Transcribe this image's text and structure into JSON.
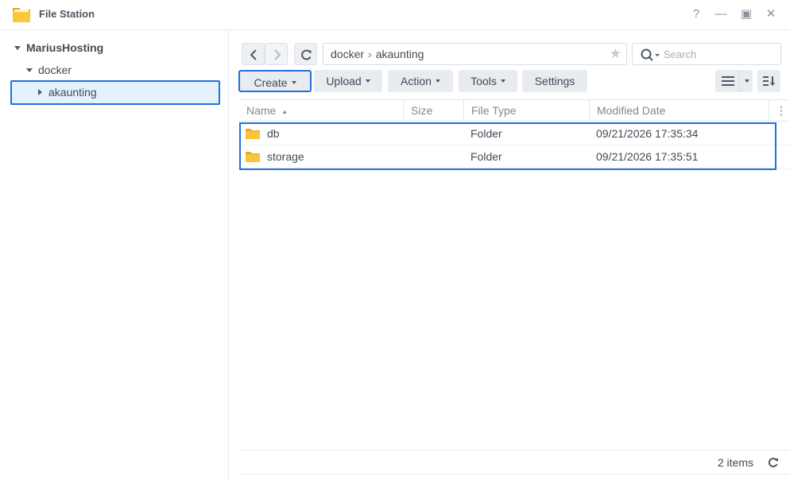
{
  "window": {
    "title": "File Station",
    "controls": [
      "?",
      "—",
      "▣",
      "✕"
    ]
  },
  "sidebar": {
    "root": "MariusHosting",
    "folder": "docker",
    "selected": "akaunting"
  },
  "toolbar": {
    "path": [
      "docker",
      "akaunting"
    ],
    "search_placeholder": "Search",
    "buttons": {
      "create": "Create",
      "upload": "Upload",
      "action": "Action",
      "tools": "Tools",
      "settings": "Settings"
    }
  },
  "table": {
    "columns": {
      "name": "Name",
      "size": "Size",
      "type": "File Type",
      "modified": "Modified Date"
    },
    "rows": [
      {
        "name": "db",
        "size": "",
        "type": "Folder",
        "modified": "09/21/2026 17:35:34"
      },
      {
        "name": "storage",
        "size": "",
        "type": "Folder",
        "modified": "09/21/2026 17:35:51"
      }
    ]
  },
  "footer": {
    "count": "2 items"
  },
  "colors": {
    "accent": "#1f6fe0",
    "folder": "#f7c43a",
    "selection_bg": "#e5f1fd"
  }
}
